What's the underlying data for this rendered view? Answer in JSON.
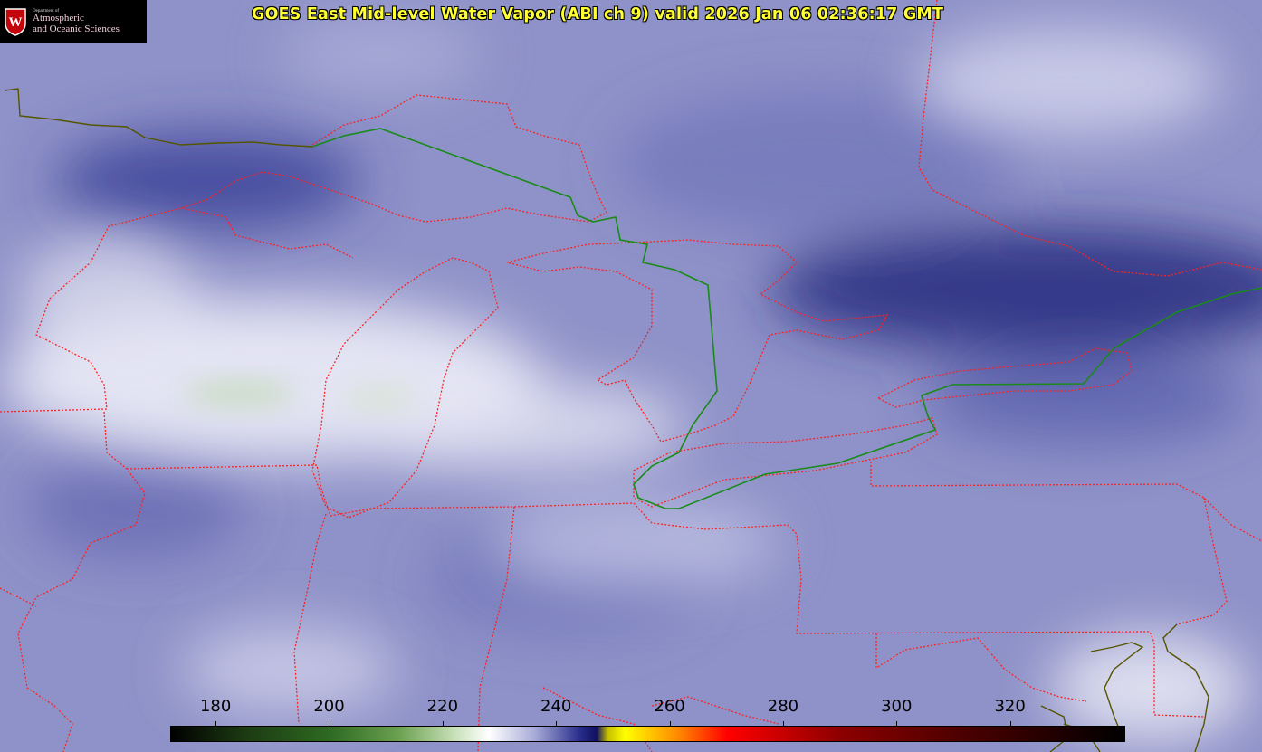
{
  "title": "GOES East Mid-level Water Vapor (ABI ch 9)  valid 2026 Jan 06 02:36:17 GMT",
  "logo": {
    "dept": "Department of",
    "line1": "Atmospheric",
    "line2": "and Oceanic Sciences",
    "seal_letter": "W"
  },
  "colorbar": {
    "ticks": [
      "180",
      "200",
      "220",
      "240",
      "260",
      "280",
      "300",
      "320"
    ],
    "min": 172,
    "max": 340,
    "stops": [
      {
        "value": 172,
        "color": "#000000"
      },
      {
        "value": 185,
        "color": "#1c3a12"
      },
      {
        "value": 200,
        "color": "#2e6a22"
      },
      {
        "value": 212,
        "color": "#6aa050"
      },
      {
        "value": 222,
        "color": "#c8e0b8"
      },
      {
        "value": 228,
        "color": "#ffffff"
      },
      {
        "value": 236,
        "color": "#a8acd8"
      },
      {
        "value": 244,
        "color": "#2a2e8c"
      },
      {
        "value": 247,
        "color": "#101060"
      },
      {
        "value": 249,
        "color": "#c8c000"
      },
      {
        "value": 252,
        "color": "#ffff00"
      },
      {
        "value": 262,
        "color": "#ff8000"
      },
      {
        "value": 270,
        "color": "#ff0000"
      },
      {
        "value": 290,
        "color": "#8c0000"
      },
      {
        "value": 310,
        "color": "#500000"
      },
      {
        "value": 340,
        "color": "#000000"
      }
    ]
  },
  "colors": {
    "background": "#8f92c8",
    "state_borders": "#ff2020",
    "intl_border": "#1a8a1a",
    "coastline": "#555500",
    "title": "#ffff33"
  }
}
